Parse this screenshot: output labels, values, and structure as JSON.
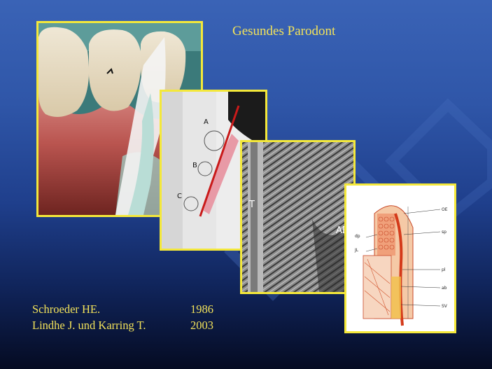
{
  "slide": {
    "title": "Gesundes Parodont",
    "accent_color": "#f4e83a",
    "background_color": "#2f56a8"
  },
  "images": {
    "clinical_photo": {
      "icon": "gingiva-photo"
    },
    "schematic": {
      "icon": "gingiva-schematic",
      "labels": [
        "A",
        "B",
        "C"
      ]
    },
    "micrograph": {
      "icon": "collagen-fibers-micrograph",
      "labels": [
        "T",
        "AB"
      ]
    },
    "histology": {
      "icon": "histology-diagram",
      "labels": [
        "OE",
        "dp",
        "JL",
        "sp",
        "pl",
        "ab",
        "SV"
      ]
    }
  },
  "references": [
    {
      "author": "Schroeder HE.",
      "year": "1986"
    },
    {
      "author": "Lindhe J. und Karring T.",
      "year": "2003"
    }
  ]
}
